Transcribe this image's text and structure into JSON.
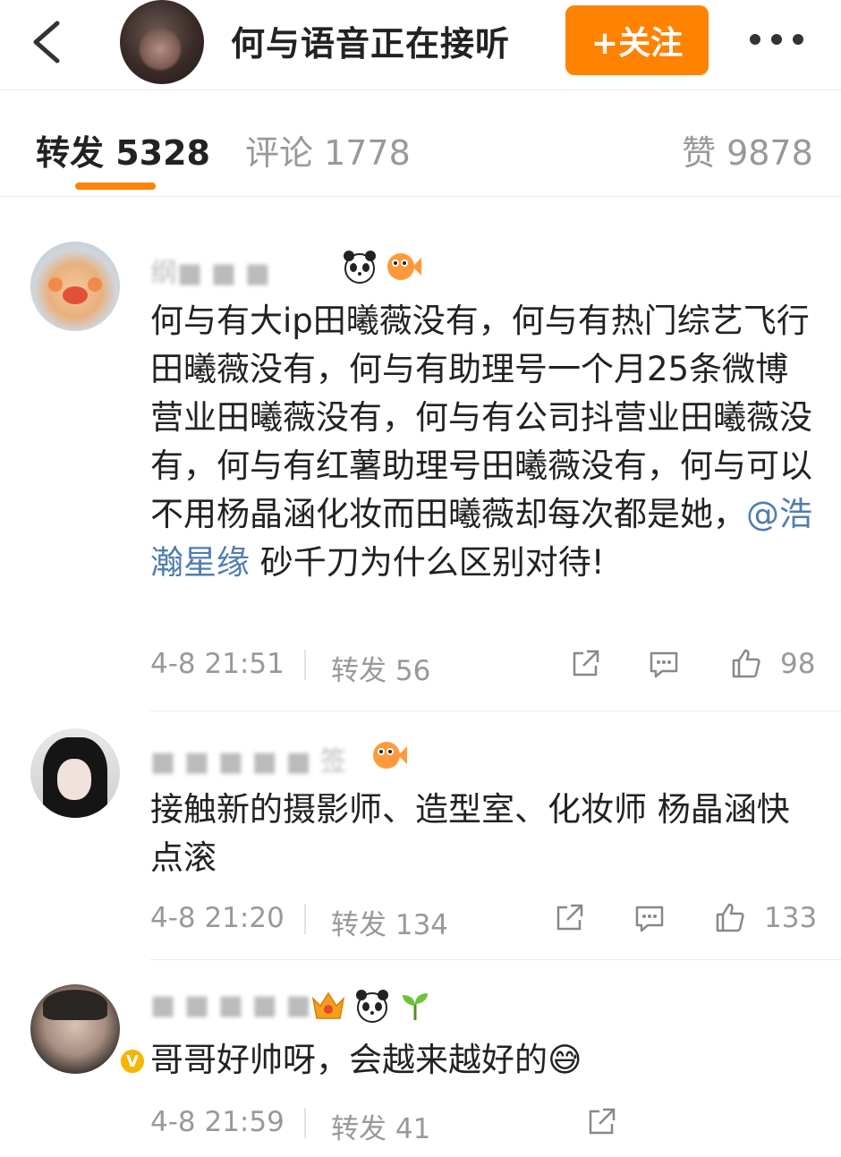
{
  "header": {
    "title": "何与语音正在接听",
    "follow_label": "+关注"
  },
  "tabs": {
    "repost": "转发 5328",
    "comments": "评论 1778",
    "likes": "赞 9878"
  },
  "comments": [
    {
      "username": "纲■ ■ ■",
      "text_before": "何与有大ip田曦薇没有，何与有热门综艺飞行田曦薇没有，何与有助理号一个月25条微博营业田曦薇没有，何与有公司抖营业田曦薇没有，何与有红薯助理号田曦薇没有，何与可以不用杨晶涵化妆而田曦薇却每次都是她，",
      "mention": "@浩瀚星缘",
      "text_after": " 砂千刀为什么区别对待!",
      "time": "4-8 21:51",
      "repost": "转发 56",
      "likes": "98",
      "badges": [
        "panda-icon",
        "fish-icon"
      ]
    },
    {
      "username": "■ ■ ■ ■ ■ 签",
      "text": "接触新的摄影师、造型室、化妆师  杨晶涵快点滚",
      "time": "4-8 21:20",
      "repost": "转发 134",
      "likes": "133",
      "badges": [
        "fish-icon"
      ]
    },
    {
      "username": "■ ■ ■ ■ ■",
      "text": "哥哥好帅呀，会越来越好的😅",
      "time": "4-8 21:59",
      "repost": "转发 41",
      "badges": [
        "crown-icon",
        "panda-icon",
        "sprout-icon"
      ],
      "verified_mark": "V"
    }
  ],
  "colors": {
    "accent": "#ff8200",
    "mention": "#507daf",
    "meta": "#999999"
  }
}
